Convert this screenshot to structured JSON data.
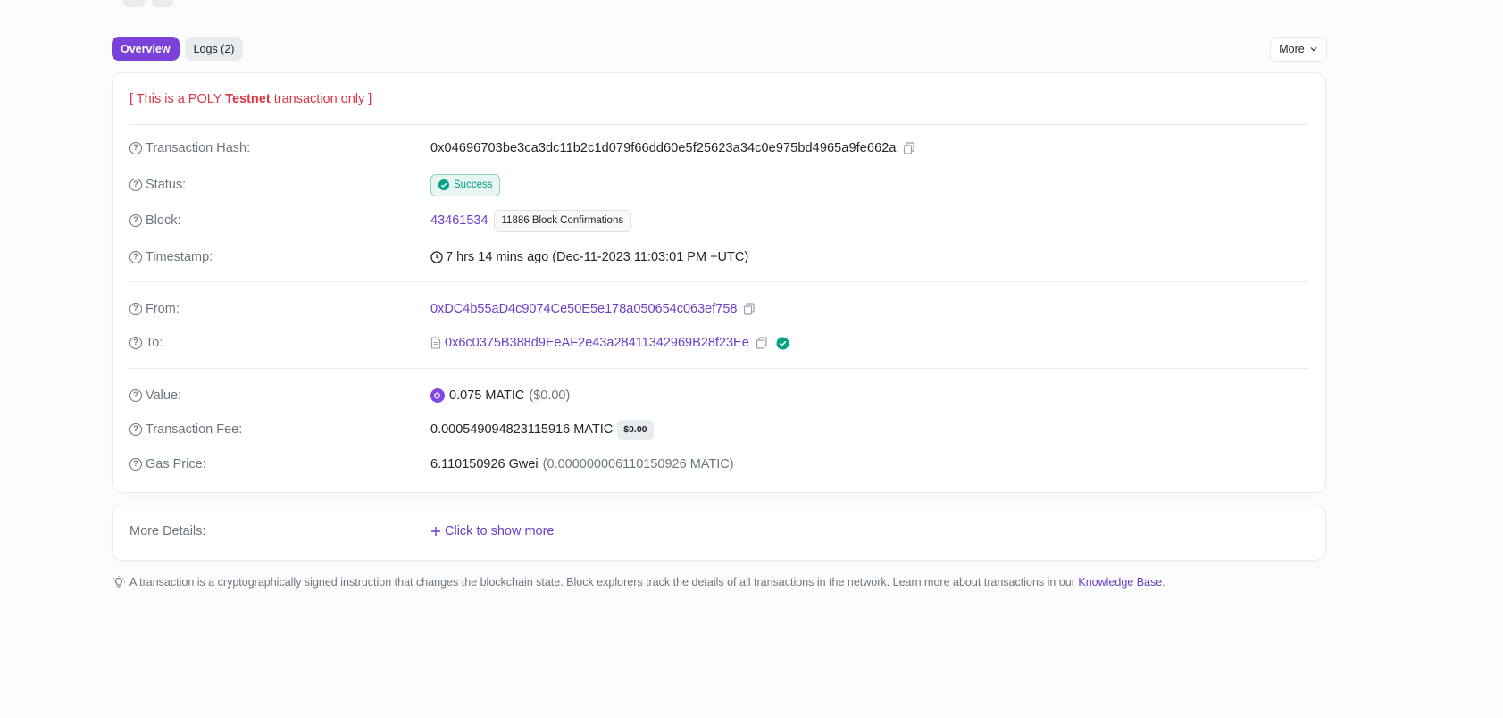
{
  "tabs": {
    "overview": "Overview",
    "logs": "Logs (2)"
  },
  "more_button": "More",
  "notice": {
    "prefix": "[ This is a POLY ",
    "bold": "Testnet",
    "suffix": " transaction only ]"
  },
  "fields": {
    "tx_hash": {
      "label": "Transaction Hash:",
      "value": "0x04696703be3ca3dc11b2c1d079f66dd60e5f25623a34c0e975bd4965a9fe662a"
    },
    "status": {
      "label": "Status:",
      "value": "Success"
    },
    "block": {
      "label": "Block:",
      "value": "43461534",
      "confirmations": "11886 Block Confirmations"
    },
    "timestamp": {
      "label": "Timestamp:",
      "value": "7 hrs 14 mins ago (Dec-11-2023 11:03:01 PM +UTC)"
    },
    "from": {
      "label": "From:",
      "value": "0xDC4b55aD4c9074Ce50E5e178a050654c063ef758"
    },
    "to": {
      "label": "To:",
      "value": "0x6c0375B388d9EeAF2e43a28411342969B28f23Ee"
    },
    "value": {
      "label": "Value:",
      "amount": "0.075 MATIC",
      "usd": "($0.00)"
    },
    "fee": {
      "label": "Transaction Fee:",
      "amount": "0.000549094823115916 MATIC",
      "usd": "$0.00"
    },
    "gas": {
      "label": "Gas Price:",
      "amount": "6.110150926 Gwei",
      "matic": "(0.000000006110150926 MATIC)"
    }
  },
  "more_details": {
    "label": "More Details:",
    "link": "Click to show more"
  },
  "footer": {
    "text": "A transaction is a cryptographically signed instruction that changes the blockchain state. Block explorers track the details of all transactions in the network. Learn more about transactions in our ",
    "link": "Knowledge Base",
    "end": "."
  },
  "colors": {
    "accent": "#7a42d9",
    "link": "#6a3fc9",
    "success": "#00a186",
    "danger": "#dc3545"
  },
  "icons": [
    "question-icon",
    "copy-icon",
    "check-circle-icon",
    "clock-icon",
    "contract-file-icon",
    "verified-icon",
    "matic-token-icon",
    "plus-icon",
    "lightbulb-icon",
    "chevron-down-icon"
  ]
}
